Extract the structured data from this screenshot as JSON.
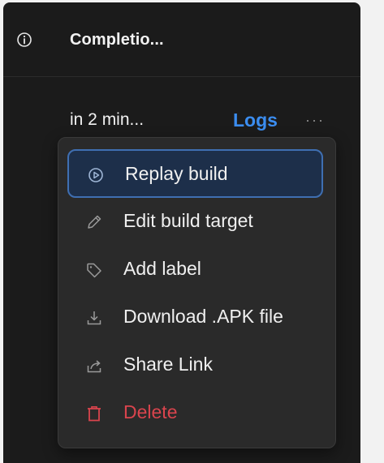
{
  "header": {
    "title": "Completio...",
    "info_icon": "info-icon"
  },
  "build": {
    "time_text": "in 2 min...",
    "logs_label": "Logs",
    "more_icon": "more-horizontal-icon",
    "more_glyph": "···"
  },
  "menu": {
    "items": [
      {
        "label": "Replay build",
        "icon": "play-circle-icon",
        "active": true
      },
      {
        "label": "Edit build target",
        "icon": "pencil-icon"
      },
      {
        "label": "Add label",
        "icon": "tag-icon"
      },
      {
        "label": "Download .APK file",
        "icon": "download-icon"
      },
      {
        "label": "Share Link",
        "icon": "share-icon"
      },
      {
        "label": "Delete",
        "icon": "trash-icon",
        "danger": true
      }
    ]
  },
  "colors": {
    "panel_bg": "#1b1b1b",
    "menu_bg": "#2a2a2a",
    "accent_blue": "#3b8df0",
    "active_bg": "#1d2f4a",
    "active_border": "#3f6fb2",
    "danger": "#d9444d"
  }
}
